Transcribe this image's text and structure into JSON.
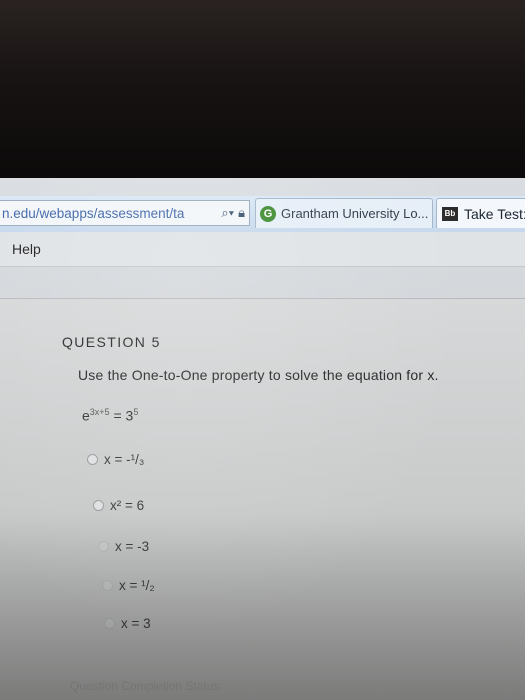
{
  "browser": {
    "url": "n.edu/webapps/assessment/ta",
    "tabs": [
      {
        "label": "Grantham University Lo...",
        "icon": "google-g-icon"
      },
      {
        "label": "Take Test:",
        "icon": "blackboard-icon"
      }
    ],
    "menu": {
      "help": "Help"
    }
  },
  "question": {
    "title": "QUESTION 5",
    "prompt": "Use the One-to-One property to solve the equation for x.",
    "equation": {
      "base": "e",
      "exponent": "3x+5",
      "equals": "= 3",
      "rhs_exponent": "5"
    },
    "options": [
      {
        "label": "x = -¹/₃"
      },
      {
        "label": "x² = 6"
      },
      {
        "label": "x = -3"
      },
      {
        "label": "x = ¹/₂"
      },
      {
        "label": "x = 3"
      }
    ]
  },
  "footer": {
    "completion": "Question Completion Status:"
  }
}
